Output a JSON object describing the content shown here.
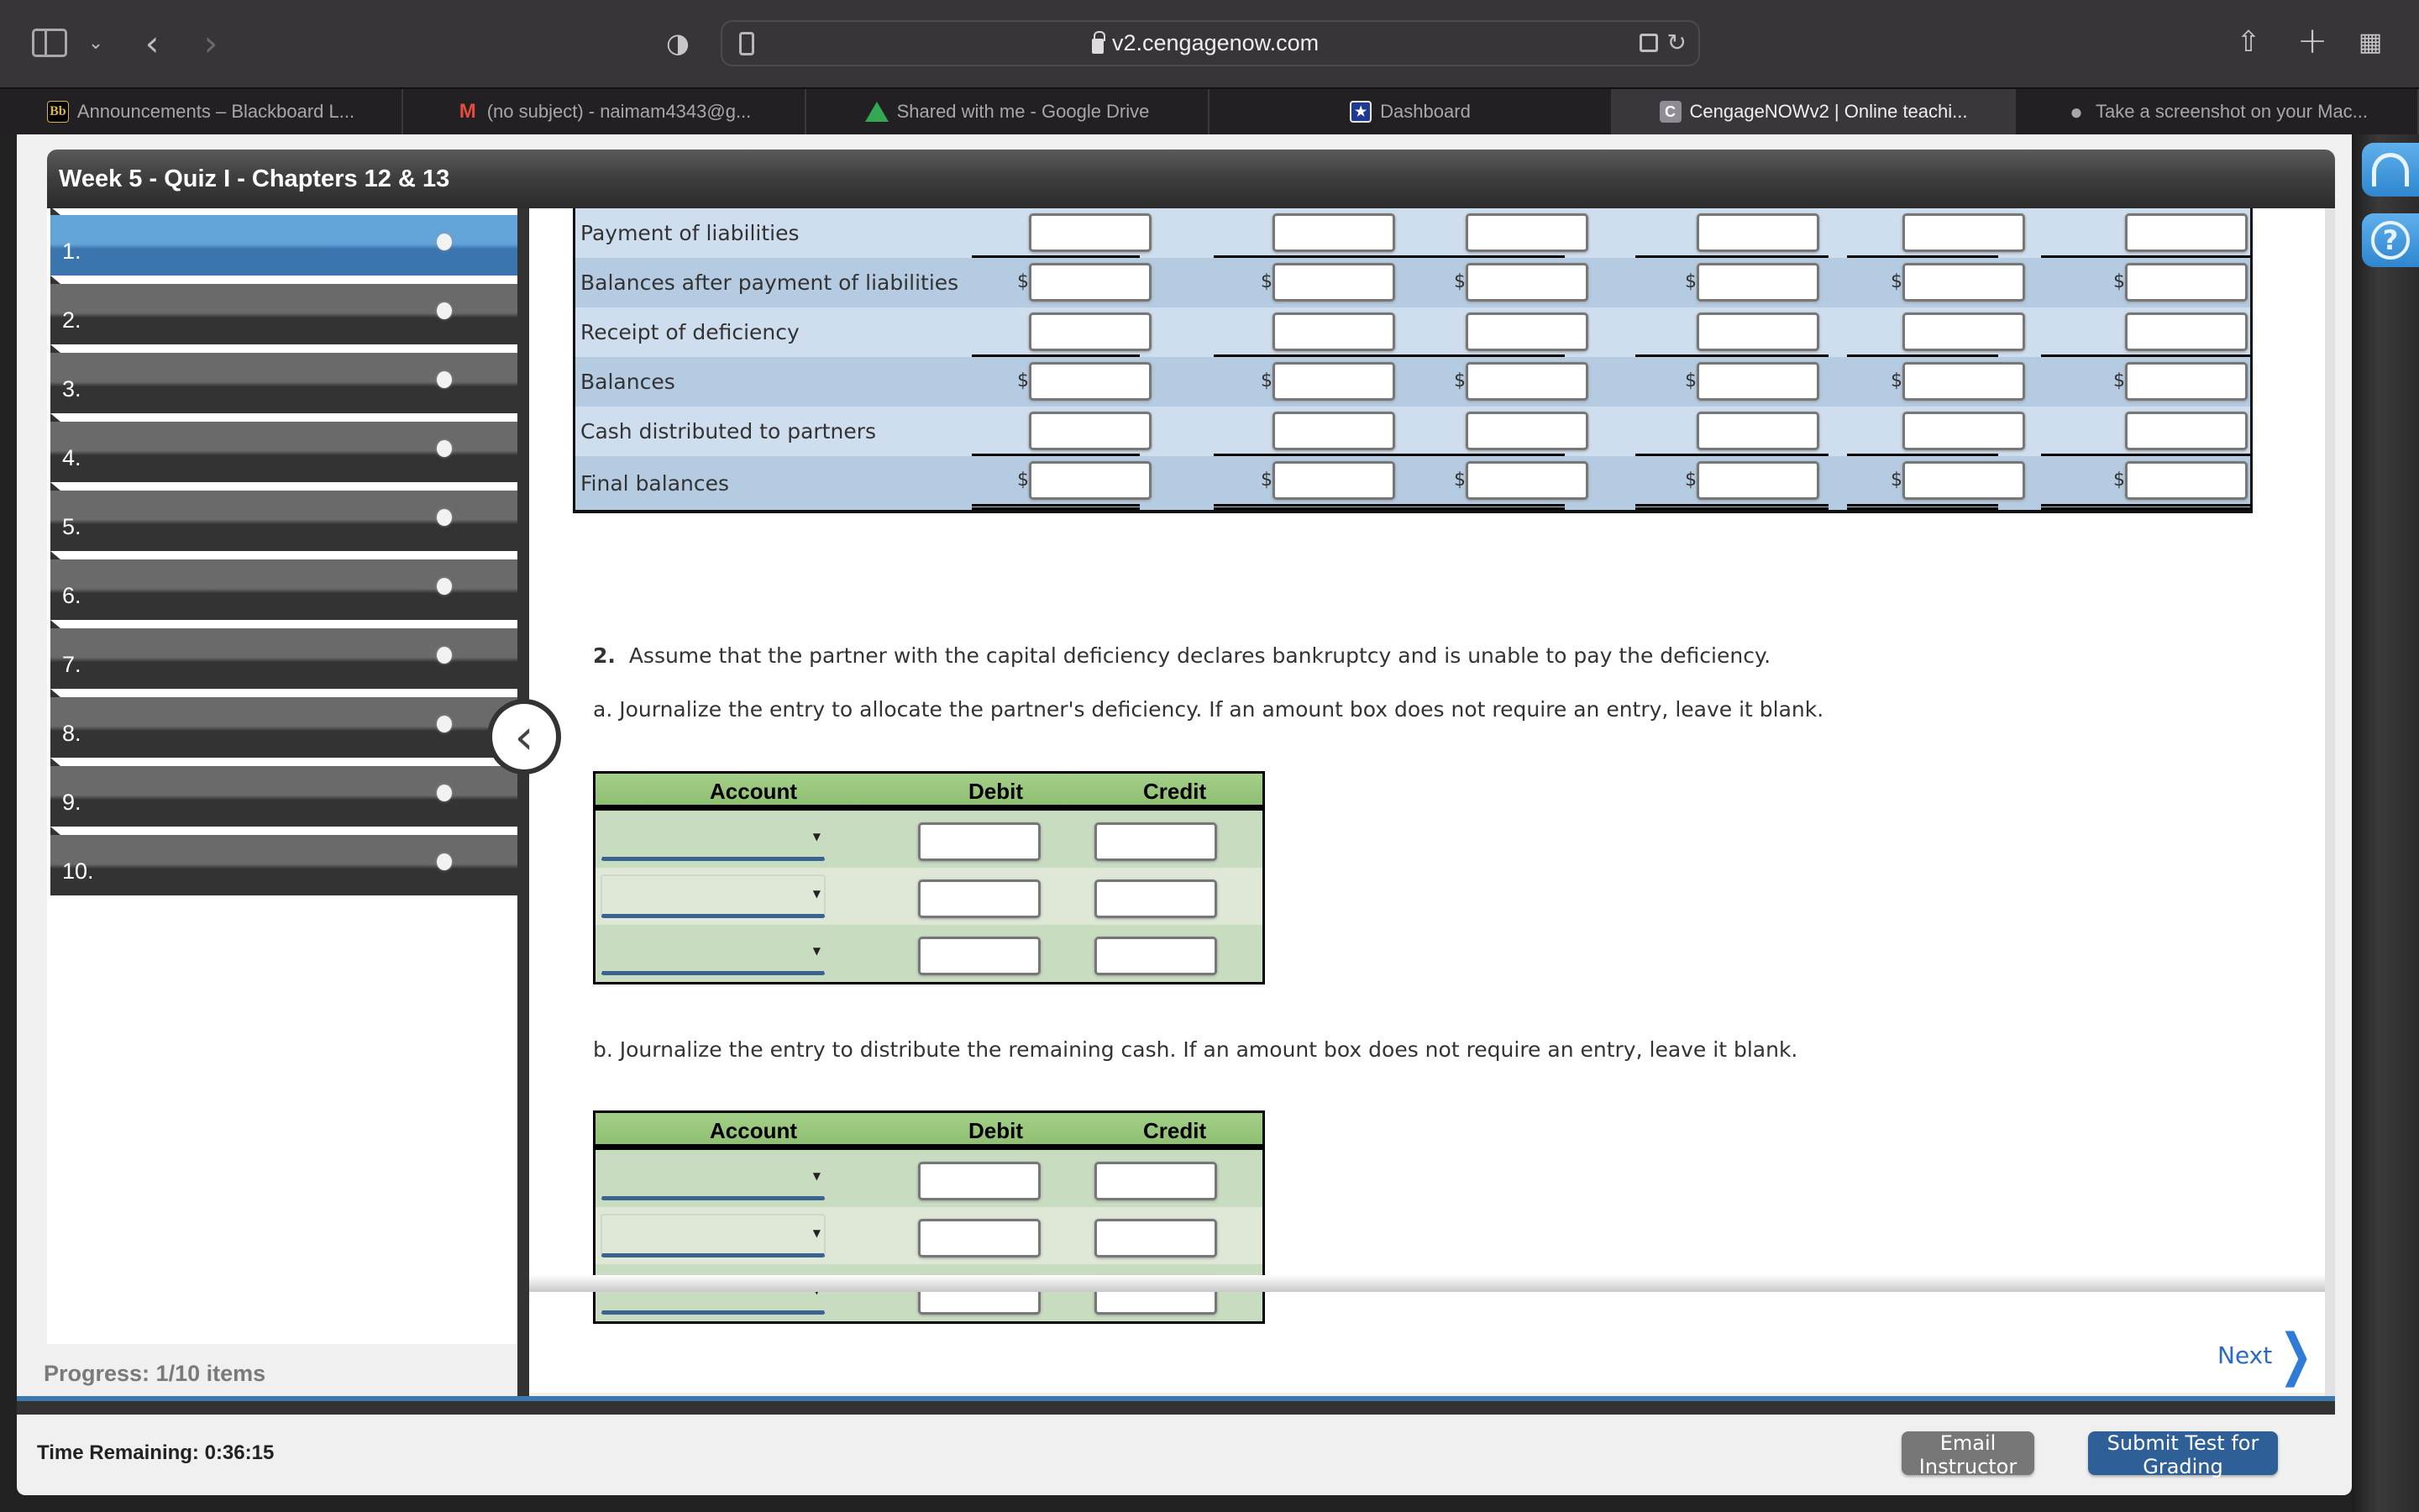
{
  "browser": {
    "url": "v2.cengagenow.com",
    "tabs": [
      {
        "label": "Announcements – Blackboard L...",
        "icon": "blackboard-icon",
        "active": false
      },
      {
        "label": "(no subject) - naimam4343@g...",
        "icon": "gmail-icon",
        "active": false
      },
      {
        "label": "Shared with me - Google Drive",
        "icon": "google-drive-icon",
        "active": false
      },
      {
        "label": "Dashboard",
        "icon": "dashboard-star-icon",
        "active": false
      },
      {
        "label": "CengageNOWv2 | Online teachi...",
        "icon": "cengage-icon",
        "active": true
      },
      {
        "label": "Take a screenshot on your Mac...",
        "icon": "apple-icon",
        "active": false
      }
    ]
  },
  "quiz": {
    "title": "Week 5 - Quiz I - Chapters 12 & 13",
    "items": [
      "1.",
      "2.",
      "3.",
      "4.",
      "5.",
      "6.",
      "7.",
      "8.",
      "9.",
      "10."
    ],
    "active_item": 0,
    "progress": "Progress:  1/10 items",
    "time_remaining": "Time Remaining: 0:36:15"
  },
  "liquidation_table": {
    "rows": [
      {
        "label": "Payment of liabilities",
        "dollar": false,
        "underline": "single",
        "values": [
          "",
          "",
          "",
          "",
          "",
          ""
        ]
      },
      {
        "label": "Balances after payment of liabilities",
        "dollar": true,
        "underline": "none",
        "values": [
          "",
          "",
          "",
          "",
          "",
          ""
        ]
      },
      {
        "label": "Receipt of deficiency",
        "dollar": false,
        "underline": "single",
        "values": [
          "",
          "",
          "",
          "",
          "",
          ""
        ]
      },
      {
        "label": "Balances",
        "dollar": true,
        "underline": "none",
        "values": [
          "",
          "",
          "",
          "",
          "",
          ""
        ]
      },
      {
        "label": "Cash distributed to partners",
        "dollar": false,
        "underline": "single",
        "values": [
          "",
          "",
          "",
          "",
          "",
          ""
        ]
      },
      {
        "label": "Final balances",
        "dollar": true,
        "underline": "double",
        "values": [
          "",
          "",
          "",
          "",
          "",
          ""
        ]
      }
    ]
  },
  "question2": {
    "number": "2.",
    "text": "Assume that the partner with the capital deficiency declares bankruptcy and is unable to pay the deficiency.",
    "part_a": "a. Journalize the entry to allocate the partner's deficiency. If an amount box does not require an entry, leave it blank.",
    "part_b": "b. Journalize the entry to distribute the remaining cash. If an amount box does not require an entry, leave it blank."
  },
  "journal": {
    "headers": {
      "account": "Account",
      "debit": "Debit",
      "credit": "Credit"
    },
    "part_a_rows": [
      {
        "account": "",
        "debit": "",
        "credit": ""
      },
      {
        "account": "",
        "debit": "",
        "credit": ""
      },
      {
        "account": "",
        "debit": "",
        "credit": ""
      }
    ],
    "part_b_rows": [
      {
        "account": "",
        "debit": "",
        "credit": ""
      },
      {
        "account": "",
        "debit": "",
        "credit": ""
      },
      {
        "account": "",
        "debit": "",
        "credit": ""
      }
    ]
  },
  "nav": {
    "next_label": "Next",
    "email_label": "Email Instructor",
    "submit_label": "Submit Test for Grading"
  },
  "colors": {
    "accent_blue": "#3b78b0",
    "submit_blue": "#2e5f97",
    "next_link": "#2a6cc4",
    "table_light": "#cfdeee",
    "table_dark": "#b5cbe1",
    "journal_header": "#9bc87e"
  }
}
